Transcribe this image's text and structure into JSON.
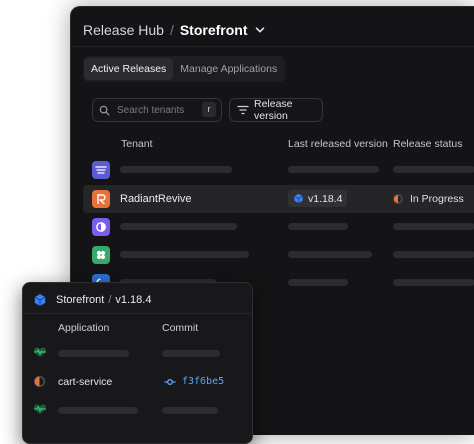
{
  "header": {
    "hub": "Release Hub",
    "separator": "/",
    "storefront": "Storefront"
  },
  "tabs": [
    {
      "label": "Active Releases",
      "active": true
    },
    {
      "label": "Manage Applications",
      "active": false
    }
  ],
  "search": {
    "placeholder": "Search tenants",
    "shortcut": "r"
  },
  "filter": {
    "label": "Release version"
  },
  "table": {
    "columns": [
      "Tenant",
      "Last released version",
      "Release status"
    ],
    "rows": [
      {
        "icon": "lines-logo-icon",
        "color": "#5b5bd6"
      },
      {
        "icon": "radiant-logo-icon",
        "color": "#e8723a",
        "tenant": "RadiantRevive",
        "version": "v1.18.4",
        "status": "In Progress",
        "selected": true
      },
      {
        "icon": "half-circle-logo-icon",
        "color": "#7b5cf0"
      },
      {
        "icon": "clover-logo-icon",
        "color": "#3aa76d"
      },
      {
        "icon": "ring-logo-icon",
        "color": "#2f6fd8"
      }
    ]
  },
  "popup": {
    "title_app": "Storefront",
    "title_sep": "/",
    "title_version": "v1.18.4",
    "columns": [
      "Application",
      "Commit"
    ],
    "rows": [
      {
        "icon": "heartbeat-icon"
      },
      {
        "icon": "spinner-icon",
        "service": "cart-service",
        "commit": "f3f6be5"
      },
      {
        "icon": "heartbeat-icon"
      }
    ]
  },
  "colors": {
    "accent_link": "#58a6ff",
    "heartbeat_green": "#2f9e5c",
    "progress_orange": "#e8723a"
  }
}
